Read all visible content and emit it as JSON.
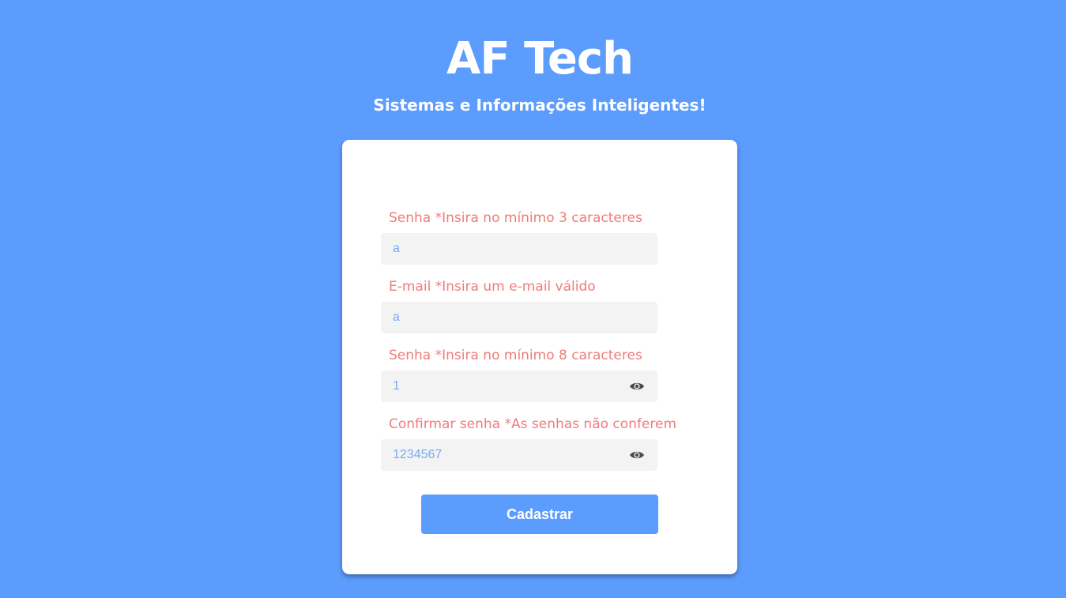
{
  "header": {
    "title": "AF Tech",
    "subtitle": "Sistemas e Informações Inteligentes!"
  },
  "form": {
    "fields": [
      {
        "label": "Senha *Insira no mínimo 3 caracteres",
        "value": "a",
        "type": "text"
      },
      {
        "label": "E-mail *Insira um e-mail válido",
        "value": "a",
        "type": "text"
      },
      {
        "label": "Senha *Insira no mínimo 8 caracteres",
        "value": "1",
        "type": "text",
        "icon": "eye-icon"
      },
      {
        "label": "Confirmar senha *As senhas não conferem",
        "value": "1234567",
        "type": "text",
        "icon": "eye-icon"
      }
    ],
    "submit_label": "Cadastrar"
  },
  "colors": {
    "background": "#5c9cfd",
    "card": "#ffffff",
    "error_label": "#f07c79",
    "input_text": "#7aaaf3",
    "input_background": "#f3f3f3",
    "button": "#5c9cfd"
  }
}
